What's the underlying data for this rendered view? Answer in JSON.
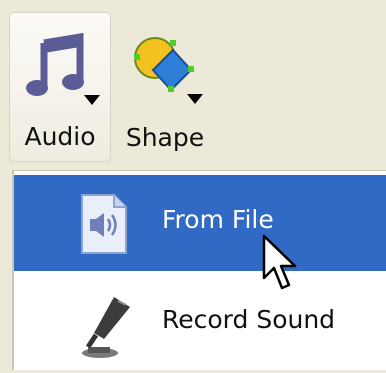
{
  "ribbon": {
    "audio": {
      "label": "Audio",
      "icon": "music-note-icon"
    },
    "shape": {
      "label": "Shape",
      "icon": "shapes-icon"
    }
  },
  "menu": {
    "items": [
      {
        "label": "From File",
        "icon": "audio-file-icon",
        "selected": true
      },
      {
        "label": "Record Sound",
        "icon": "microphone-icon",
        "selected": false
      }
    ]
  },
  "colors": {
    "selection": "#316ac5",
    "toolbar": "#ece9d8"
  }
}
